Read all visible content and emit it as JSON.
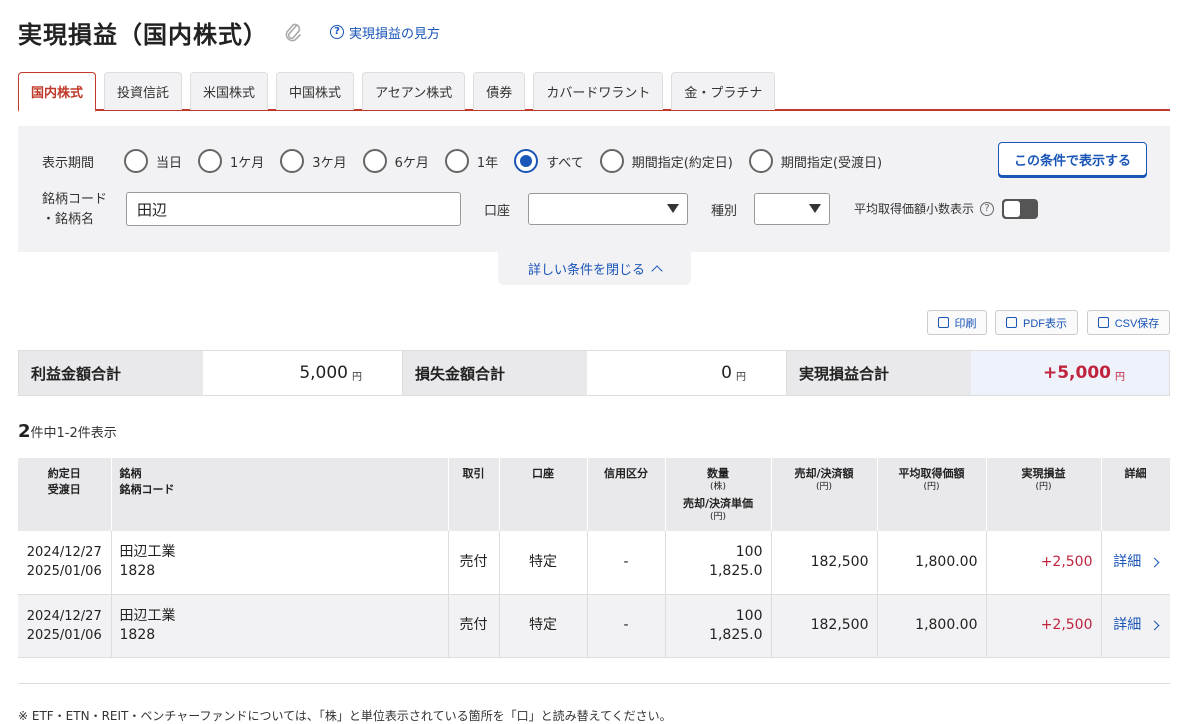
{
  "header": {
    "title": "実現損益（国内株式）",
    "help_link": "実現損益の見方"
  },
  "tabs": [
    "国内株式",
    "投資信託",
    "米国株式",
    "中国株式",
    "アセアン株式",
    "債券",
    "カバードワラント",
    "金・プラチナ"
  ],
  "search": {
    "period_label": "表示期間",
    "periods": [
      "当日",
      "1ケ月",
      "3ケ月",
      "6ケ月",
      "1年",
      "すべて",
      "期間指定(約定日)",
      "期間指定(受渡日)"
    ],
    "selected_period": "すべて",
    "apply_button": "この条件で表示する",
    "code_label_1": "銘柄コード",
    "code_label_2": "・銘柄名",
    "name_value": "田辺",
    "account_label": "口座",
    "account_value": "",
    "type_label": "種別",
    "type_value": "",
    "avg_label": "平均取得価額小数表示",
    "collapse_label": "詳しい条件を閉じる"
  },
  "tools": {
    "print": "印刷",
    "pdf": "PDF表示",
    "csv": "CSV保存"
  },
  "summary": {
    "profit_label": "利益金額合計",
    "profit_value": "5,000",
    "loss_label": "損失金額合計",
    "loss_value": "0",
    "total_label": "実現損益合計",
    "total_value": "+5,000",
    "unit": "円"
  },
  "count": {
    "total": "2",
    "text": "件中1-2件表示"
  },
  "table": {
    "headers": {
      "date1": "約定日",
      "date2": "受渡日",
      "name1": "銘柄",
      "name2": "銘柄コード",
      "trade": "取引",
      "account": "口座",
      "credit": "信用区分",
      "qty": "数量",
      "qty_unit": "(株)",
      "price": "売却/決済単価",
      "price_unit": "(円)",
      "amount": "売却/決済額",
      "amount_unit": "(円)",
      "avg": "平均取得価額",
      "avg_unit": "(円)",
      "pl": "実現損益",
      "pl_unit": "(円)",
      "detail": "詳細"
    },
    "rows": [
      {
        "trade_date": "2024/12/27",
        "settle_date": "2025/01/06",
        "name": "田辺工業",
        "code": "1828",
        "trade": "売付",
        "account": "特定",
        "credit": "-",
        "qty": "100",
        "price": "1,825.0",
        "amount": "182,500",
        "avg": "1,800.00",
        "pl": "+2,500",
        "detail": "詳細"
      },
      {
        "trade_date": "2024/12/27",
        "settle_date": "2025/01/06",
        "name": "田辺工業",
        "code": "1828",
        "trade": "売付",
        "account": "特定",
        "credit": "-",
        "qty": "100",
        "price": "1,825.0",
        "amount": "182,500",
        "avg": "1,800.00",
        "pl": "+2,500",
        "detail": "詳細"
      }
    ]
  },
  "footnote": "※ ETF・ETN・REIT・ベンチャーファンドについては、「株」と単位表示されている箇所を「口」と読み替えてください。",
  "colors": {
    "accent": "#c0392b",
    "link": "#1a55b8",
    "gain": "#c0233e"
  }
}
